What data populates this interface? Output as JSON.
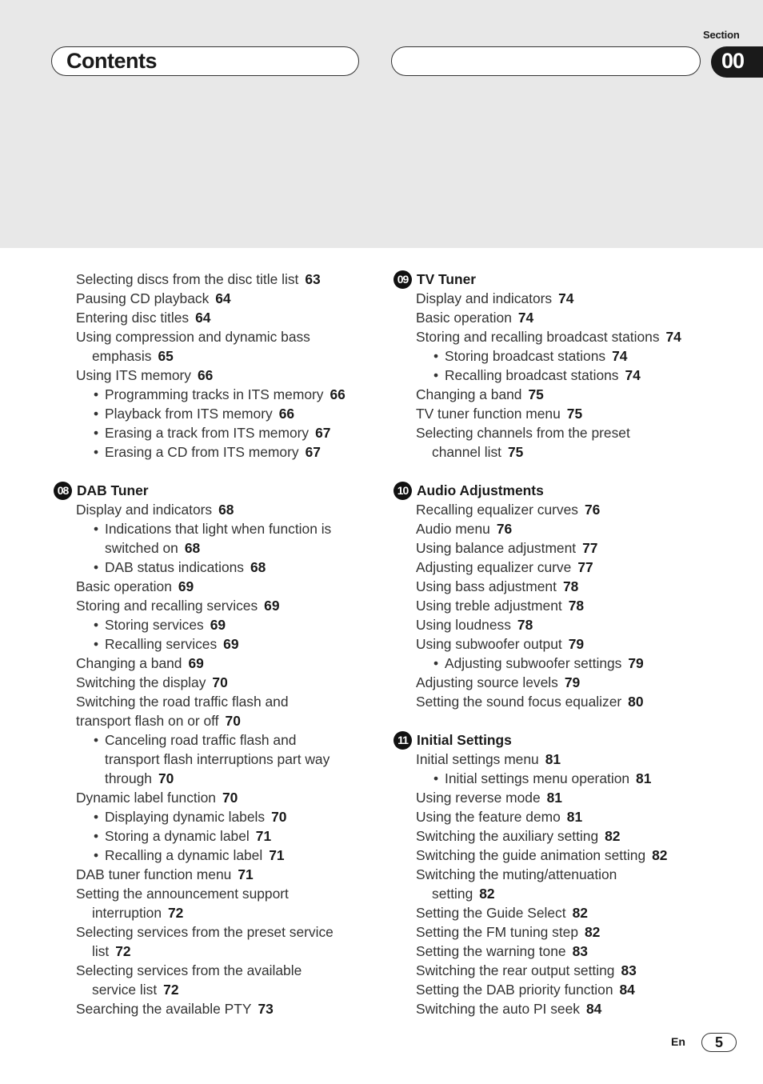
{
  "header": {
    "title": "Contents",
    "section_label": "Section",
    "section_number": "00"
  },
  "left_column": [
    {
      "type": "l1",
      "text": "Selecting discs from the disc title list",
      "page": "63"
    },
    {
      "type": "l1",
      "text": "Pausing CD playback",
      "page": "64"
    },
    {
      "type": "l1",
      "text": "Entering disc titles",
      "page": "64"
    },
    {
      "type": "l1",
      "text": "Using compression and dynamic bass",
      "page": ""
    },
    {
      "type": "l1c",
      "text": "emphasis",
      "page": "65"
    },
    {
      "type": "l1",
      "text": "Using ITS memory",
      "page": "66"
    },
    {
      "type": "l2",
      "text": "Programming tracks in ITS memory",
      "page": "66"
    },
    {
      "type": "l2",
      "text": "Playback from ITS memory",
      "page": "66"
    },
    {
      "type": "l2",
      "text": "Erasing a track from ITS memory",
      "page": "67"
    },
    {
      "type": "l2",
      "text": "Erasing a CD from ITS memory",
      "page": "67"
    },
    {
      "type": "gap"
    },
    {
      "type": "heading",
      "badge": "08",
      "text": "DAB Tuner"
    },
    {
      "type": "l1",
      "text": "Display and indicators",
      "page": "68"
    },
    {
      "type": "l2",
      "text": "Indications that light when function is",
      "page": ""
    },
    {
      "type": "l2c",
      "text": "switched on",
      "page": "68"
    },
    {
      "type": "l2",
      "text": "DAB status indications",
      "page": "68"
    },
    {
      "type": "l1",
      "text": "Basic operation",
      "page": "69"
    },
    {
      "type": "l1",
      "text": "Storing and recalling services",
      "page": "69"
    },
    {
      "type": "l2",
      "text": "Storing services",
      "page": "69"
    },
    {
      "type": "l2",
      "text": "Recalling services",
      "page": "69"
    },
    {
      "type": "l1",
      "text": "Changing a band",
      "page": "69"
    },
    {
      "type": "l1",
      "text": "Switching the display",
      "page": "70"
    },
    {
      "type": "l1",
      "text": "Switching the road traffic flash and",
      "page": ""
    },
    {
      "type": "l1",
      "text": "transport flash on or off",
      "page": "70"
    },
    {
      "type": "l2",
      "text": "Canceling road traffic flash and",
      "page": ""
    },
    {
      "type": "l2c",
      "text": "transport flash interruptions part way",
      "page": ""
    },
    {
      "type": "l2c",
      "text": "through",
      "page": "70"
    },
    {
      "type": "l1",
      "text": "Dynamic label function",
      "page": "70"
    },
    {
      "type": "l2",
      "text": "Displaying dynamic labels",
      "page": "70"
    },
    {
      "type": "l2",
      "text": "Storing a dynamic label",
      "page": "71"
    },
    {
      "type": "l2",
      "text": "Recalling a dynamic label",
      "page": "71"
    },
    {
      "type": "l1",
      "text": "DAB tuner function menu",
      "page": "71"
    },
    {
      "type": "l1",
      "text": "Setting the announcement support",
      "page": ""
    },
    {
      "type": "l1c",
      "text": "interruption",
      "page": "72"
    },
    {
      "type": "l1",
      "text": "Selecting services from the preset service",
      "page": ""
    },
    {
      "type": "l1c",
      "text": "list",
      "page": "72"
    },
    {
      "type": "l1",
      "text": "Selecting services from the available",
      "page": ""
    },
    {
      "type": "l1c",
      "text": "service list",
      "page": "72"
    },
    {
      "type": "l1",
      "text": "Searching the available PTY",
      "page": "73"
    }
  ],
  "right_column": [
    {
      "type": "heading",
      "badge": "09",
      "text": "TV Tuner"
    },
    {
      "type": "l1",
      "text": "Display and indicators",
      "page": "74"
    },
    {
      "type": "l1",
      "text": "Basic operation",
      "page": "74"
    },
    {
      "type": "l1",
      "text": "Storing and recalling broadcast stations",
      "page": "74"
    },
    {
      "type": "l2",
      "text": "Storing broadcast stations",
      "page": "74"
    },
    {
      "type": "l2",
      "text": "Recalling broadcast stations",
      "page": "74"
    },
    {
      "type": "l1",
      "text": "Changing a band",
      "page": "75"
    },
    {
      "type": "l1",
      "text": "TV tuner function menu",
      "page": "75"
    },
    {
      "type": "l1",
      "text": "Selecting channels from the preset",
      "page": ""
    },
    {
      "type": "l1c",
      "text": "channel list",
      "page": "75"
    },
    {
      "type": "gap"
    },
    {
      "type": "heading",
      "badge": "10",
      "text": "Audio Adjustments"
    },
    {
      "type": "l1",
      "text": "Recalling equalizer curves",
      "page": "76"
    },
    {
      "type": "l1",
      "text": "Audio menu",
      "page": "76"
    },
    {
      "type": "l1",
      "text": "Using balance adjustment",
      "page": "77"
    },
    {
      "type": "l1",
      "text": "Adjusting equalizer curve",
      "page": "77"
    },
    {
      "type": "l1",
      "text": "Using bass adjustment",
      "page": "78"
    },
    {
      "type": "l1",
      "text": "Using treble adjustment",
      "page": "78"
    },
    {
      "type": "l1",
      "text": "Using loudness",
      "page": "78"
    },
    {
      "type": "l1",
      "text": "Using subwoofer output",
      "page": "79"
    },
    {
      "type": "l2",
      "text": "Adjusting subwoofer settings",
      "page": "79"
    },
    {
      "type": "l1",
      "text": "Adjusting source levels",
      "page": "79"
    },
    {
      "type": "l1",
      "text": "Setting the sound focus equalizer",
      "page": "80"
    },
    {
      "type": "gap"
    },
    {
      "type": "heading",
      "badge": "11",
      "text": "Initial Settings"
    },
    {
      "type": "l1",
      "text": "Initial settings menu",
      "page": "81"
    },
    {
      "type": "l2",
      "text": "Initial settings menu operation",
      "page": "81"
    },
    {
      "type": "l1",
      "text": "Using reverse mode",
      "page": "81"
    },
    {
      "type": "l1",
      "text": "Using the feature demo",
      "page": "81"
    },
    {
      "type": "l1",
      "text": "Switching the auxiliary setting",
      "page": "82"
    },
    {
      "type": "l1",
      "text": "Switching the guide animation setting",
      "page": "82"
    },
    {
      "type": "l1",
      "text": "Switching the muting/attenuation",
      "page": ""
    },
    {
      "type": "l1c",
      "text": "setting",
      "page": "82"
    },
    {
      "type": "l1",
      "text": "Setting the Guide Select",
      "page": "82"
    },
    {
      "type": "l1",
      "text": "Setting the FM tuning step",
      "page": "82"
    },
    {
      "type": "l1",
      "text": "Setting the warning tone",
      "page": "83"
    },
    {
      "type": "l1",
      "text": "Switching the rear output setting",
      "page": "83"
    },
    {
      "type": "l1",
      "text": "Setting the DAB priority function",
      "page": "84"
    },
    {
      "type": "l1",
      "text": "Switching the auto PI seek",
      "page": "84"
    }
  ],
  "footer": {
    "language": "En",
    "page_number": "5"
  }
}
